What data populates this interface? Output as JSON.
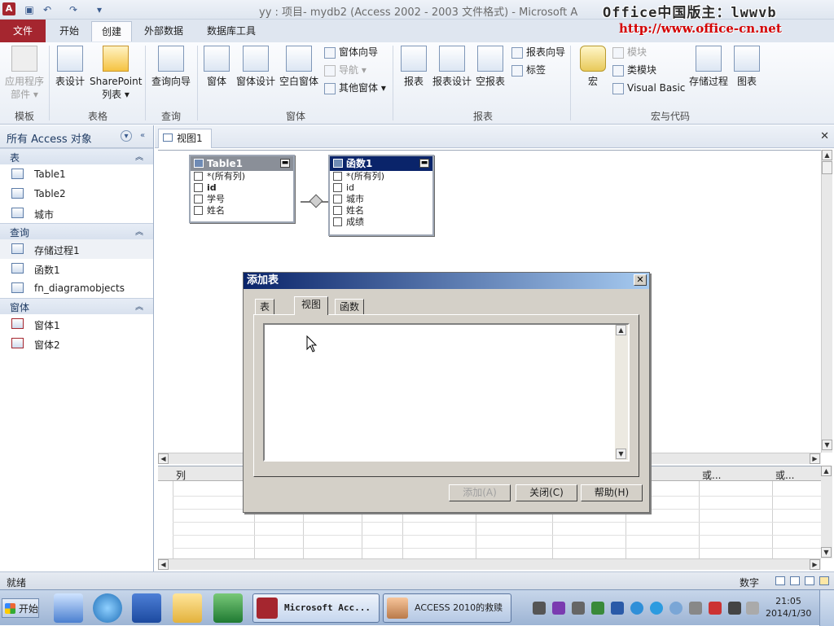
{
  "window": {
    "title": "yy : 项目- mydb2 (Access 2002 - 2003 文件格式) - Microsoft A",
    "app_icon_letter": "A",
    "watermark_line1": "Office中国版主：lwwvb",
    "watermark_line2": "http://www.office-cn.net"
  },
  "ribbon_tabs": [
    "文件",
    "开始",
    "创建",
    "外部数据",
    "数据库工具"
  ],
  "ribbon": {
    "groups": {
      "templates": "模板",
      "tables": "表格",
      "queries": "查询",
      "forms": "窗体",
      "reports": "报表",
      "macros": "宏与代码"
    },
    "buttons": {
      "app_parts_1": "应用程序",
      "app_parts_2": "部件 ▾",
      "table_design": "表设计",
      "sharepoint_1": "SharePoint",
      "sharepoint_2": "列表 ▾",
      "query_wizard": "查询向导",
      "form": "窗体",
      "form_design": "窗体设计",
      "blank_form": "空白窗体",
      "form_wizard": "窗体向导",
      "navigation": "导航 ▾",
      "more_forms": "其他窗体 ▾",
      "report": "报表",
      "report_design": "报表设计",
      "blank_report": "空报表",
      "report_wizard": "报表向导",
      "labels": "标签",
      "macro": "宏",
      "module": "模块",
      "class_module": "类模块",
      "visual_basic": "Visual Basic",
      "stored_procedure": "存储过程",
      "chart": "图表"
    }
  },
  "nav": {
    "title": "所有 Access 对象",
    "groups": [
      {
        "label": "表",
        "items": [
          "Table1",
          "Table2",
          "城市"
        ]
      },
      {
        "label": "查询",
        "items": [
          "存储过程1",
          "函数1",
          "fn_diagramobjects"
        ]
      },
      {
        "label": "窗体",
        "items": [
          "窗体1",
          "窗体2"
        ]
      }
    ]
  },
  "document": {
    "tab_label": "视图1",
    "tables": [
      {
        "title": "Table1",
        "fields": [
          "*(所有列)",
          "id",
          "学号",
          "姓名"
        ]
      },
      {
        "title": "函数1",
        "fields": [
          "*(所有列)",
          "id",
          "城市",
          "姓名",
          "成绩"
        ]
      }
    ],
    "grid_headers": {
      "column": "列",
      "or1": "或...",
      "or2": "或..."
    }
  },
  "dialog": {
    "title": "添加表",
    "tabs": [
      "表",
      "视图",
      "函数"
    ],
    "active_tab": "视图",
    "buttons": {
      "add": "添加(A)",
      "close": "关闭(C)",
      "help": "帮助(H)"
    }
  },
  "statusbar": {
    "left": "就绪",
    "right": "数字"
  },
  "taskbar": {
    "start": "开始",
    "windows": [
      "Microsoft Acc...",
      "ACCESS 2010的救赎"
    ],
    "clock_time": "21:05",
    "clock_date": "2014/1/30"
  },
  "colors": {
    "access_red": "#a5262f",
    "dialog_title": "#0a246a",
    "table_title_inactive": "#8a8f98",
    "table_title_active": "#0a246a"
  }
}
